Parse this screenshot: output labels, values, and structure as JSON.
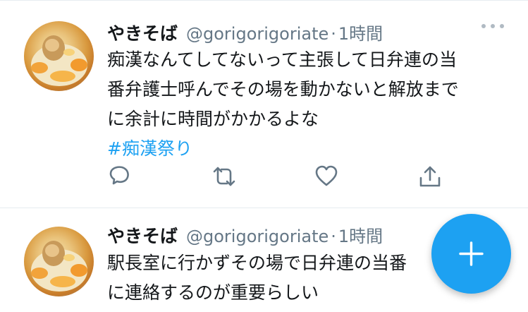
{
  "tweets": [
    {
      "name": "やきそば",
      "handle": "@gorigorigoriate",
      "separator": "·",
      "time": "1時間",
      "lines": [
        "痴漢なんてしてないって主張して日弁連の当",
        "番弁護士呼んでその場を動かないと解放まで",
        "に余計に時間がかかるよな"
      ],
      "hashtag": "#痴漢祭り",
      "actions": [
        "reply-icon",
        "retweet-icon",
        "like-icon",
        "share-icon"
      ],
      "menu_icon": "more-icon"
    },
    {
      "name": "やきそば",
      "handle": "@gorigorigoriate",
      "separator": "·",
      "time": "1時間",
      "lines": [
        "駅長室に行かずその場で日弁連の当番",
        "に連絡するのが重要らしい"
      ]
    }
  ],
  "fab": {
    "icon": "compose-plus-icon"
  },
  "colors": {
    "accent": "#1da1f2",
    "secondary_text": "#657786",
    "divider": "#e6ecf0"
  }
}
